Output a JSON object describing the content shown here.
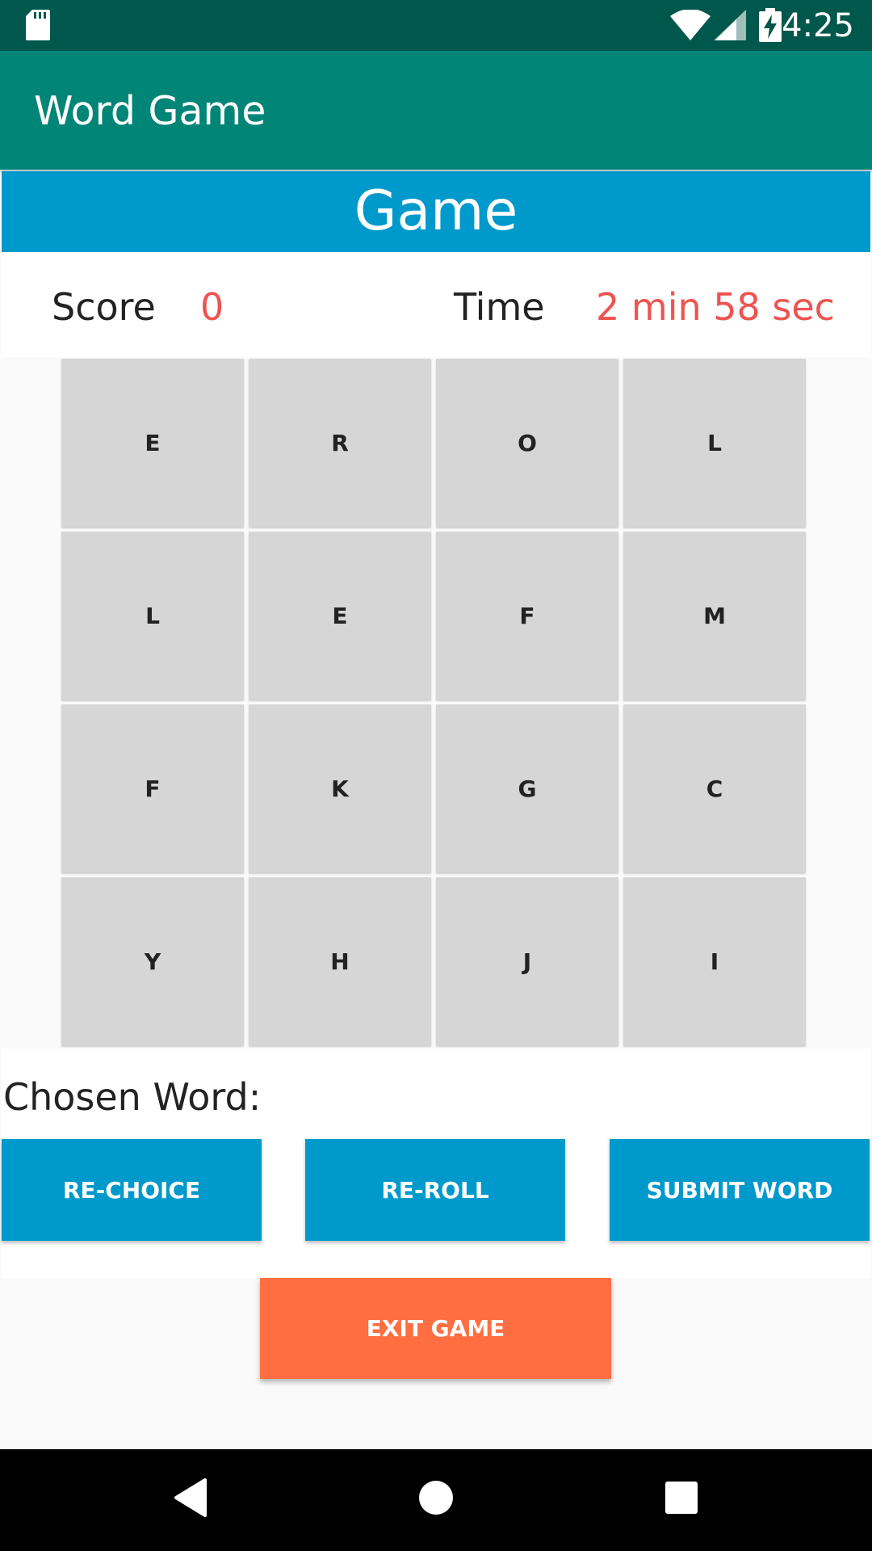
{
  "status_bar": {
    "time": "4:25",
    "icons": [
      "sd-card-icon",
      "wifi-icon",
      "signal-icon",
      "battery-charging-icon"
    ]
  },
  "app_bar": {
    "title": "Word Game"
  },
  "game": {
    "header": "Game",
    "score_label": "Score",
    "score_value": "0",
    "time_label": "Time",
    "time_value": "2 min 58 sec"
  },
  "grid": {
    "rows": [
      [
        "E",
        "R",
        "O",
        "L"
      ],
      [
        "L",
        "E",
        "F",
        "M"
      ],
      [
        "F",
        "K",
        "G",
        "C"
      ],
      [
        "Y",
        "H",
        "J",
        "I"
      ]
    ]
  },
  "word_panel": {
    "chosen_label": "Chosen Word:",
    "rechoice_label": "RE-CHOICE",
    "reroll_label": "RE-ROLL",
    "submit_label": "SUBMIT WORD"
  },
  "exit_label": "EXIT GAME",
  "nav": {
    "icons": [
      "back-icon",
      "home-icon",
      "recents-icon"
    ]
  },
  "colors": {
    "status_bar": "#00574b",
    "app_bar": "#008577",
    "primary_blue": "#0099cc",
    "score_red": "#ef5350",
    "tile_gray": "#d6d6d6",
    "exit_orange": "#ff6e40"
  }
}
